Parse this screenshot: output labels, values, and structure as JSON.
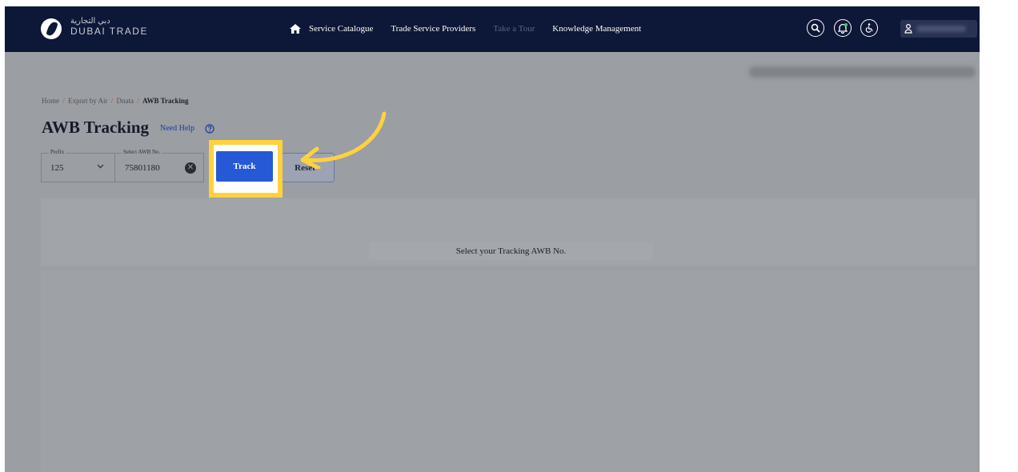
{
  "brand": {
    "name_ar": "دبي التجارية",
    "name_en": "DUBAI TRADE"
  },
  "nav": {
    "items": [
      {
        "label": "Service Catalogue"
      },
      {
        "label": "Trade Service Providers"
      },
      {
        "label": "Take a Tour"
      },
      {
        "label": "Knowledge Management"
      }
    ]
  },
  "breadcrumb": {
    "home": "Home",
    "item1": "Export by Air",
    "item2": "Dnata",
    "current": "AWB Tracking",
    "separator": "/"
  },
  "page": {
    "title": "AWB Tracking",
    "help_link": "Need Help"
  },
  "form": {
    "prefix_label": "Prefix",
    "prefix_value": "125",
    "awb_label": "Select AWB No.",
    "awb_value": "75801180",
    "track_label": "Track",
    "reset_label": "Reset"
  },
  "result": {
    "placeholder": "Select your Tracking AWB No."
  },
  "colors": {
    "topbar": "#0d1737",
    "overlay": "#9b9ea3",
    "primary": "#2659d5",
    "highlight": "#ffd23d",
    "breadcrumb_separator": "#c9520e"
  }
}
